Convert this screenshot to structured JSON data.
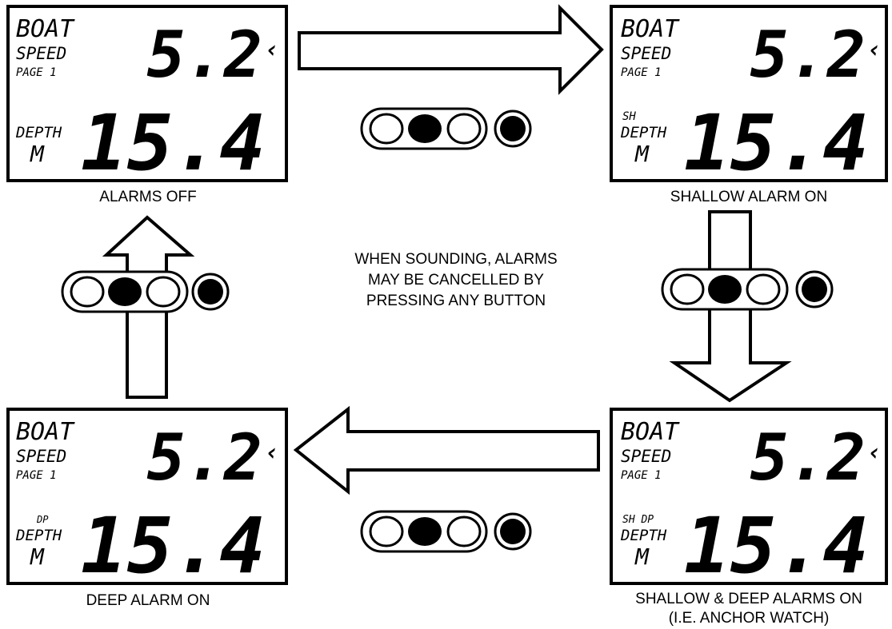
{
  "note": {
    "lines": [
      "WHEN SOUNDING, ALARMS",
      "MAY BE CANCELLED BY",
      "PRESSING ANY BUTTON"
    ]
  },
  "lcd": {
    "boat": "BOAT",
    "speed": "SPEED",
    "page": "PAGE 1",
    "depth": "DEPTH",
    "unit": "M",
    "speed_value": "5.2",
    "speed_marker": "‹",
    "depth_value": "15.4"
  },
  "panels": {
    "tl": {
      "caption": [
        "ALARMS OFF"
      ],
      "indicator": ""
    },
    "tr": {
      "caption": [
        "SHALLOW ALARM ON"
      ],
      "indicator": "SH"
    },
    "br": {
      "caption": [
        "SHALLOW & DEEP ALARMS ON",
        "(I.E. ANCHOR WATCH)"
      ],
      "indicator": "SH DP"
    },
    "bl": {
      "caption": [
        "DEEP ALARM ON"
      ],
      "indicator": "DP"
    }
  },
  "buttons": {
    "layout": "three-key pill (middle key filled) + single round key (filled)"
  },
  "colors": {
    "ink": "#000000",
    "paper": "#ffffff"
  }
}
